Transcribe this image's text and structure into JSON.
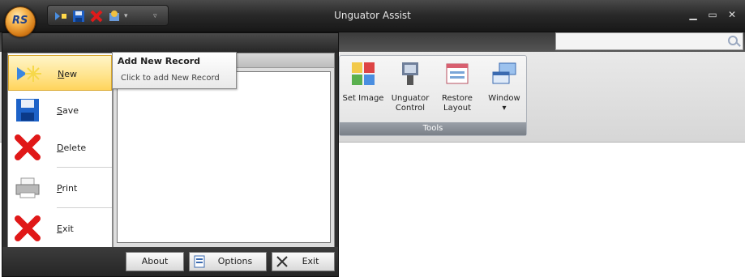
{
  "window": {
    "title": "Unguator Assist",
    "controls": [
      "minimize-icon",
      "maximize-icon",
      "close-icon"
    ]
  },
  "orb": {
    "label": "RS"
  },
  "quick_access": [
    {
      "icon": "new-icon"
    },
    {
      "icon": "save-icon"
    },
    {
      "icon": "delete-icon"
    },
    {
      "icon": "options-icon"
    },
    {
      "icon": "dropdown-arrow-icon"
    },
    {
      "icon": "customize-icon"
    }
  ],
  "search": {
    "placeholder": ""
  },
  "ribbon": {
    "group_label": "Tools",
    "buttons": [
      {
        "label_line1": "Set Image",
        "label_line2": "",
        "icon": "set-image-icon"
      },
      {
        "label_line1": "Unguator",
        "label_line2": "Control",
        "icon": "unguator-control-icon"
      },
      {
        "label_line1": "Restore",
        "label_line2": "Layout",
        "icon": "restore-layout-icon"
      },
      {
        "label_line1": "Window",
        "label_line2": "▾",
        "icon": "window-icon"
      }
    ]
  },
  "app_menu": {
    "items": [
      {
        "label": "New",
        "icon": "new-icon"
      },
      {
        "label": "Save",
        "icon": "save-icon"
      },
      {
        "label": "Delete",
        "icon": "delete-icon"
      },
      {
        "label": "Print",
        "icon": "print-icon"
      },
      {
        "label": "Exit",
        "icon": "exit-icon"
      }
    ],
    "bottom_buttons": [
      {
        "label": "About"
      },
      {
        "label": "Options",
        "icon": "options-icon"
      },
      {
        "label": "Exit",
        "icon": "exit-x-icon"
      }
    ]
  },
  "tooltip": {
    "title": "Add New Record",
    "description": "Click to add New Record"
  }
}
